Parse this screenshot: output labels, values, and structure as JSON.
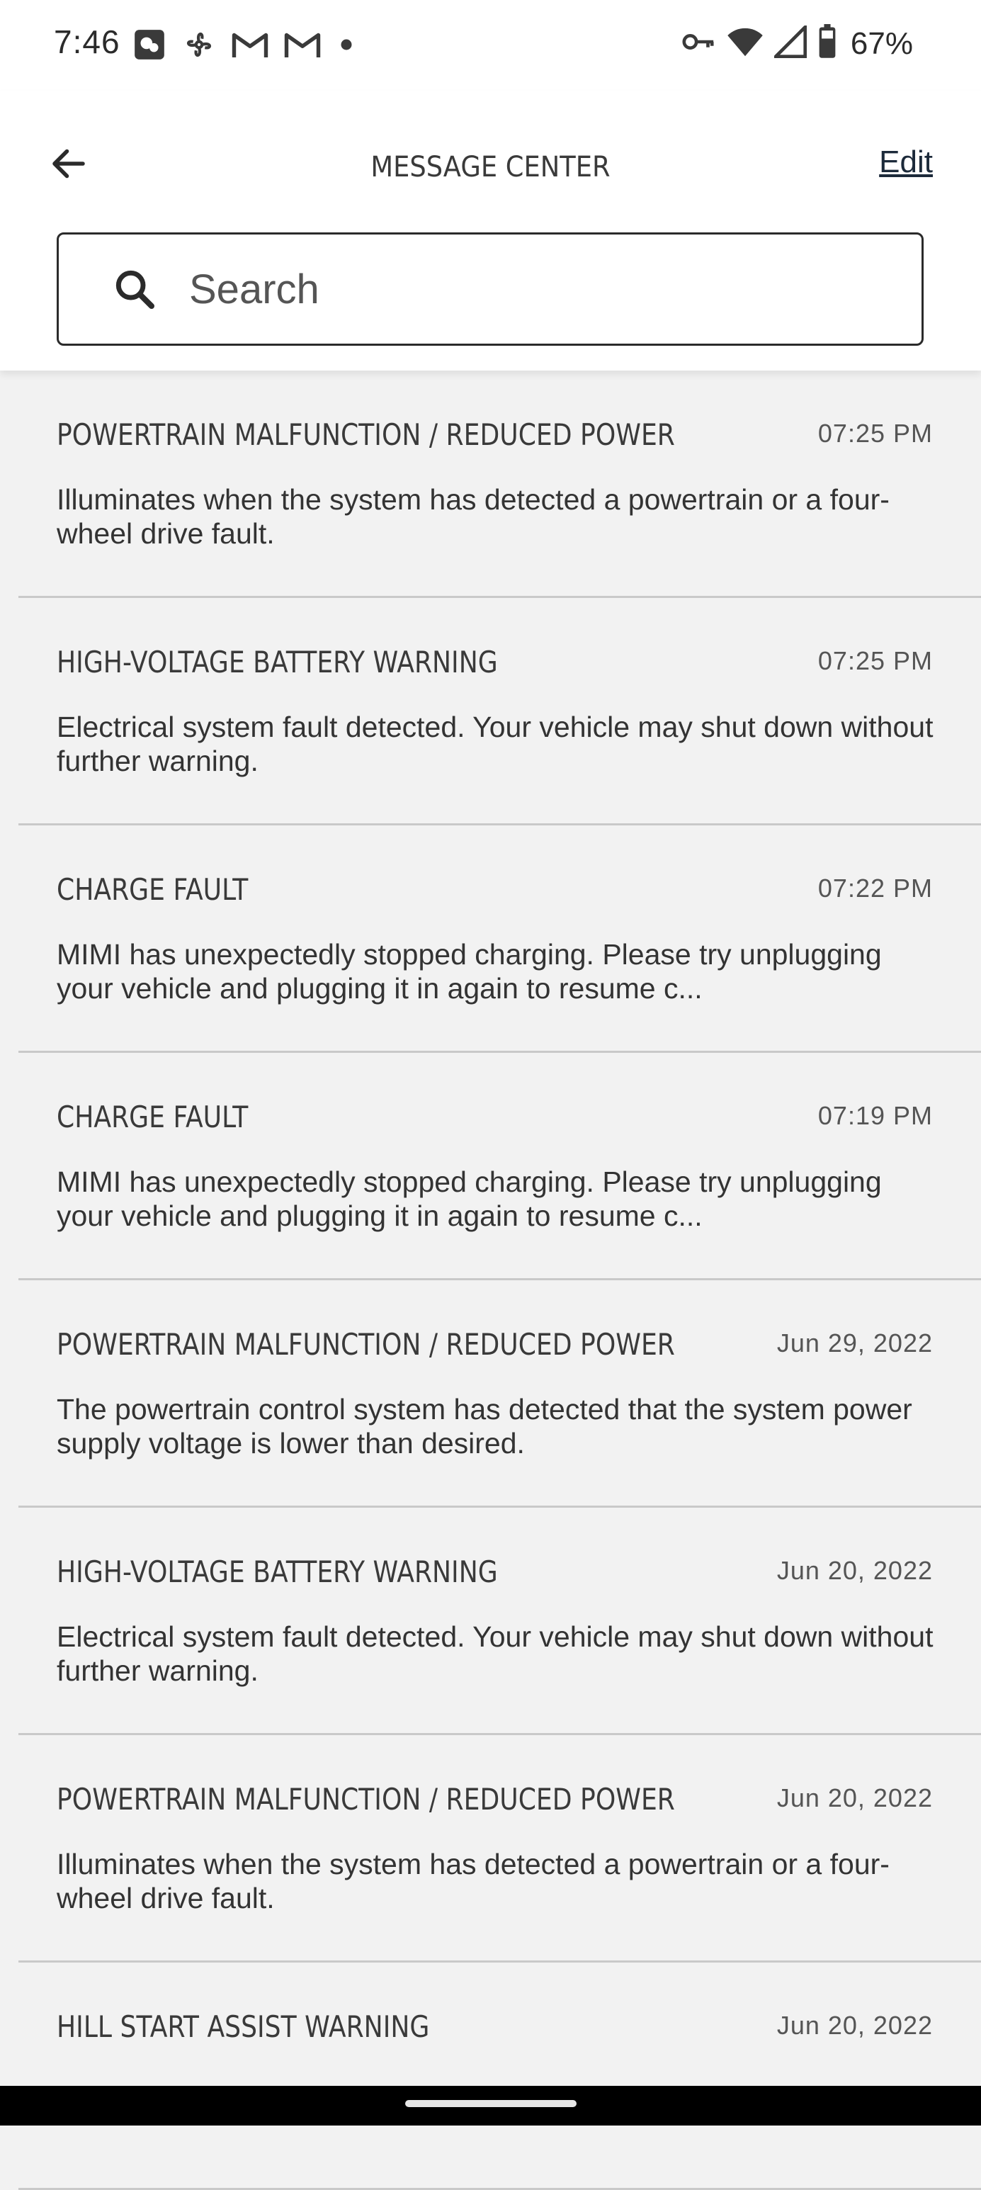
{
  "status_bar": {
    "time": "7:46",
    "battery_percent": "67%",
    "left_icons": [
      "photo-notification-icon",
      "fan-icon",
      "gmail-icon",
      "gmail-icon",
      "dot-icon"
    ],
    "right_icons": [
      "vpn-key-icon",
      "wifi-icon",
      "cell-signal-icon",
      "battery-icon"
    ]
  },
  "header": {
    "title": "MESSAGE CENTER",
    "edit_label": "Edit",
    "back_icon": "arrow-left-icon"
  },
  "search": {
    "placeholder": "Search",
    "value": ""
  },
  "messages": [
    {
      "title": "POWERTRAIN MALFUNCTION / REDUCED POWER",
      "time": "07:25 PM",
      "body": "Illuminates when the system has detected a powertrain or a four-wheel drive fault."
    },
    {
      "title": "HIGH-VOLTAGE BATTERY WARNING",
      "time": "07:25 PM",
      "body": "Electrical system fault detected. Your vehicle may shut down without further warning."
    },
    {
      "title": "CHARGE FAULT",
      "time": "07:22 PM",
      "body": "MIMI has unexpectedly stopped charging. Please try unplugging your vehicle and plugging it in again to resume c..."
    },
    {
      "title": "CHARGE FAULT",
      "time": "07:19 PM",
      "body": "MIMI has unexpectedly stopped charging. Please try unplugging your vehicle and plugging it in again to resume c..."
    },
    {
      "title": "POWERTRAIN MALFUNCTION / REDUCED POWER",
      "time": "Jun 29, 2022",
      "body": "The powertrain control system has detected that the system power supply voltage is lower than desired."
    },
    {
      "title": "HIGH-VOLTAGE BATTERY WARNING",
      "time": "Jun 20, 2022",
      "body": "Electrical system fault detected. Your vehicle may shut down without further warning."
    },
    {
      "title": "POWERTRAIN MALFUNCTION / REDUCED POWER",
      "time": "Jun 20, 2022",
      "body": "Illuminates when the system has detected a powertrain or a four-wheel drive fault."
    },
    {
      "title": "HILL START ASSIST WARNING",
      "time": "Jun 20, 2022",
      "body": ""
    }
  ],
  "colors": {
    "background": "#f2f2f2",
    "header_background": "#ffffff",
    "divider": "#c9c9c9",
    "text_primary": "#333333",
    "link": "#1c2a3a"
  }
}
